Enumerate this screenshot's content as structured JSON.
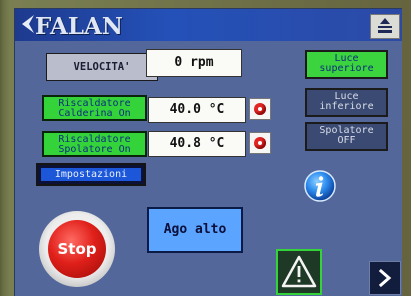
{
  "header": {
    "brand": "FALAN",
    "logo_icon": "chevron-logo-icon",
    "menu_icon": "machine-menu-icon"
  },
  "main": {
    "velocita_label": "VELOCITA'",
    "velocita_value": "0 rpm",
    "heater1_label_lines": [
      "Riscaldatore",
      "Calderina On"
    ],
    "heater1_value": "40.0 °C",
    "heater2_label_lines": [
      "Riscaldatore",
      "Spolatore On"
    ],
    "heater2_value": "40.8 °C",
    "impostazioni_label": "Impostazioni",
    "ago_label": "Ago alto",
    "stop_label": "Stop"
  },
  "right": {
    "luce_sup_lines": [
      "Luce",
      "superiore"
    ],
    "luce_inf_lines": [
      "Luce",
      "inferiore"
    ],
    "spol_lines": [
      "Spolatore",
      "OFF"
    ]
  },
  "icons": {
    "info": "info-icon",
    "warning": "warning-icon",
    "next": "chevron-right-icon",
    "indicator": "red-indicator-icon"
  },
  "colors": {
    "panel": "#53679a",
    "header": "#2451b8",
    "active_green": "#35d33a",
    "indicator_red": "#e22423",
    "ago_blue": "#5ba4ff",
    "impostazioni_blue": "#1b57d8"
  }
}
